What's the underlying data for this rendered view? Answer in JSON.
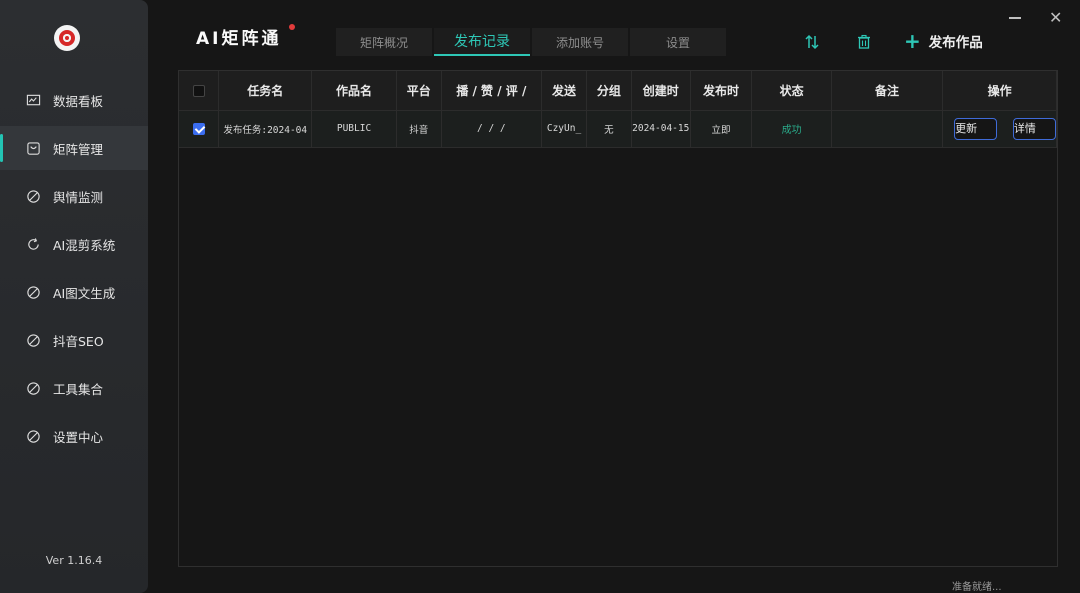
{
  "sidebar": {
    "items": [
      {
        "label": "数据看板",
        "icon": "chart-icon"
      },
      {
        "label": "矩阵管理",
        "icon": "box-icon",
        "active": true
      },
      {
        "label": "舆情监测",
        "icon": "ban-icon"
      },
      {
        "label": "AI混剪系统",
        "icon": "refresh-icon"
      },
      {
        "label": "AI图文生成",
        "icon": "ban-icon"
      },
      {
        "label": "抖音SEO",
        "icon": "ban-icon"
      },
      {
        "label": "工具集合",
        "icon": "ban-icon"
      },
      {
        "label": "设置中心",
        "icon": "ban-icon"
      }
    ],
    "version": "Ver 1.16.4"
  },
  "header": {
    "brand": "AI矩阵通",
    "tabs": [
      {
        "label": "矩阵概况"
      },
      {
        "label": "发布记录",
        "active": true
      },
      {
        "label": "添加账号"
      },
      {
        "label": "设置"
      }
    ],
    "publish_label": "发布作品"
  },
  "table": {
    "headers": [
      "",
      "任务名",
      "作品名",
      "平台",
      "播 / 赞 / 评 /",
      "发送",
      "分组",
      "创建时",
      "发布时",
      "状态",
      "备注",
      "操作"
    ],
    "rows": [
      {
        "checked": true,
        "task": "发布任务:2024-04",
        "work": "PUBLIC",
        "platform": "抖音",
        "stats": "/ / /",
        "send": "CzyUn_",
        "group": "无",
        "created": "2024-04-15",
        "publish": "立即",
        "status": "成功",
        "note": "",
        "btn_update": "更新",
        "btn_detail": "详情"
      }
    ]
  },
  "status_bar": "准备就绪...",
  "colors": {
    "accent": "#2ec7b6",
    "checkbox": "#3b6df0",
    "success": "#2aaa8a"
  }
}
